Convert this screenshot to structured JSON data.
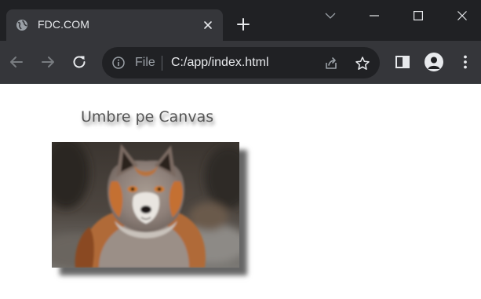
{
  "browser": {
    "tab": {
      "title": "FDC.COM",
      "favicon": "globe-icon",
      "close_icon": "close-icon"
    },
    "new_tab_icon": "plus-icon",
    "window_controls": [
      "chevron-down-icon",
      "minimize-icon",
      "maximize-icon",
      "close-icon"
    ],
    "toolbar": {
      "back_icon": "arrow-left-icon",
      "forward_icon": "arrow-right-icon",
      "reload_icon": "reload-icon",
      "omnibox": {
        "info_icon": "info-icon",
        "scheme": "File",
        "url": "C:/app/index.html",
        "share_icon": "share-icon",
        "bookmark_icon": "star-icon"
      },
      "side_panel_icon": "side-panel-icon",
      "profile_icon": "profile-icon",
      "menu_icon": "kebab-menu-icon"
    },
    "colors": {
      "titlebar": "#202124",
      "tab": "#35363a",
      "toolbar": "#35363a",
      "omnibox": "#202124",
      "text": "#e8eaed",
      "muted": "#9aa0a6"
    }
  },
  "page": {
    "heading": "Umbre pe Canvas",
    "image": "fox-photo",
    "colors": {
      "heading": "#555555",
      "background": "#ffffff"
    }
  }
}
